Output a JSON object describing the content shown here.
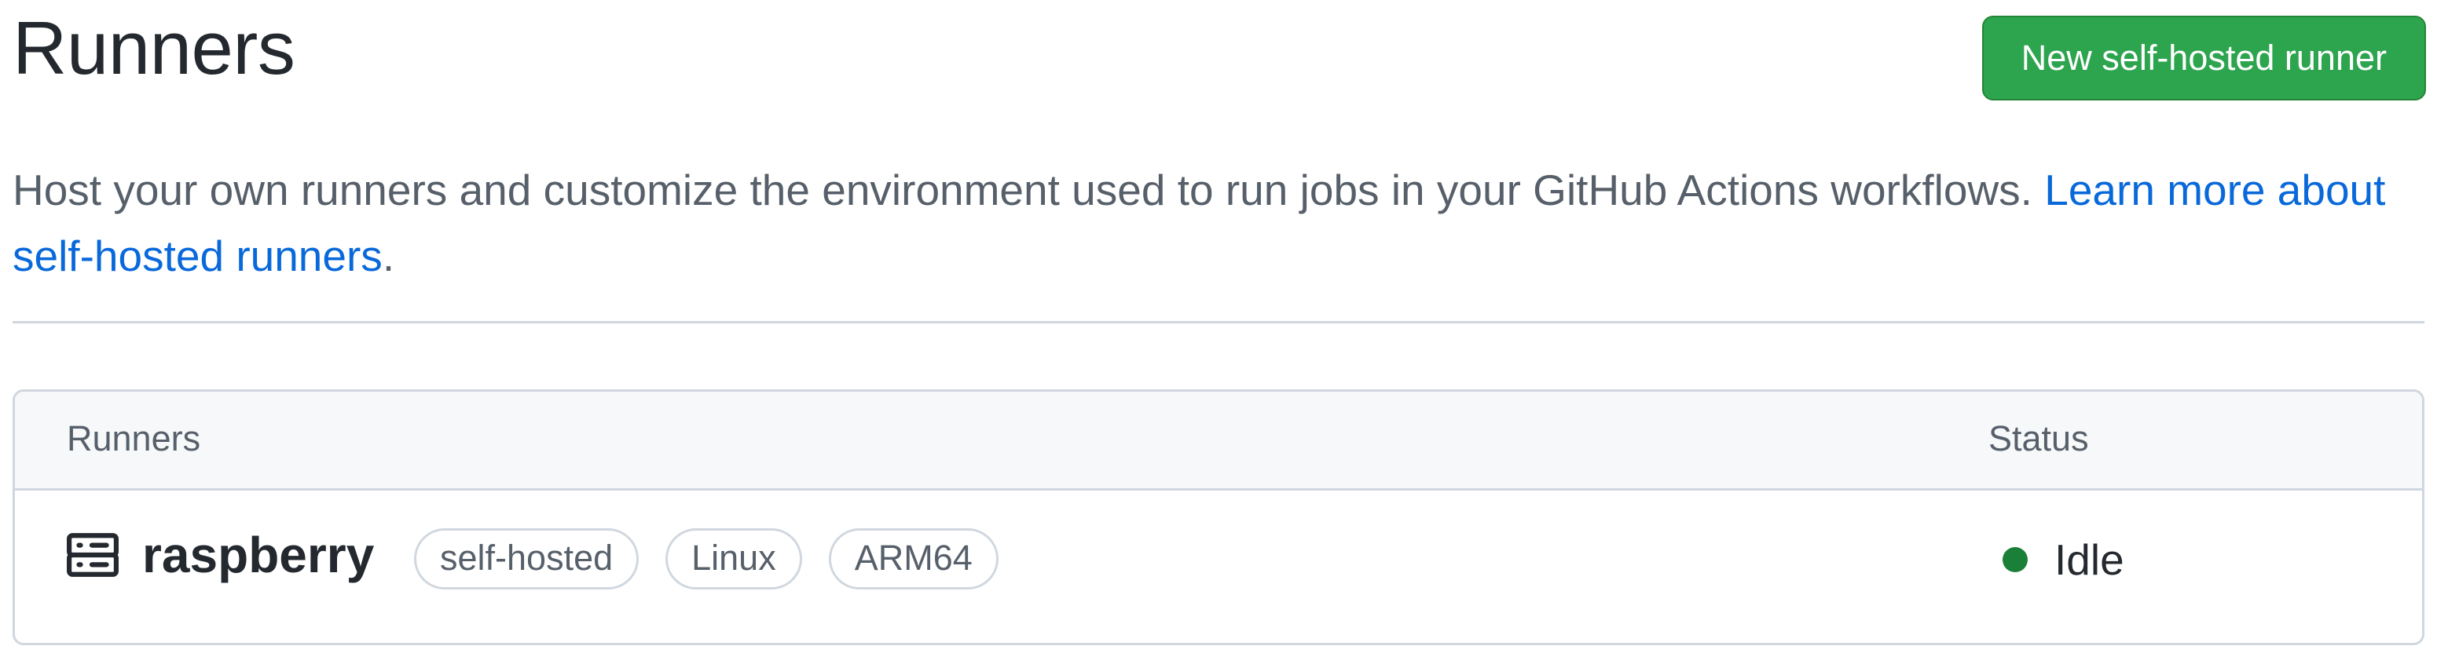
{
  "header": {
    "title": "Runners",
    "new_runner_button": "New self-hosted runner"
  },
  "description": {
    "text": "Host your own runners and customize the environment used to run jobs in your GitHub Actions workflows. ",
    "link_text": "Learn more about self-hosted runners",
    "suffix": "."
  },
  "table": {
    "columns": {
      "runners": "Runners",
      "status": "Status"
    },
    "rows": [
      {
        "icon": "server-icon",
        "name": "raspberry",
        "labels": [
          "self-hosted",
          "Linux",
          "ARM64"
        ],
        "status": "Idle",
        "status_color": "#1a7f37"
      }
    ]
  },
  "colors": {
    "primary_button": "#2da44e",
    "link": "#0969da",
    "status_idle": "#1a7f37"
  }
}
